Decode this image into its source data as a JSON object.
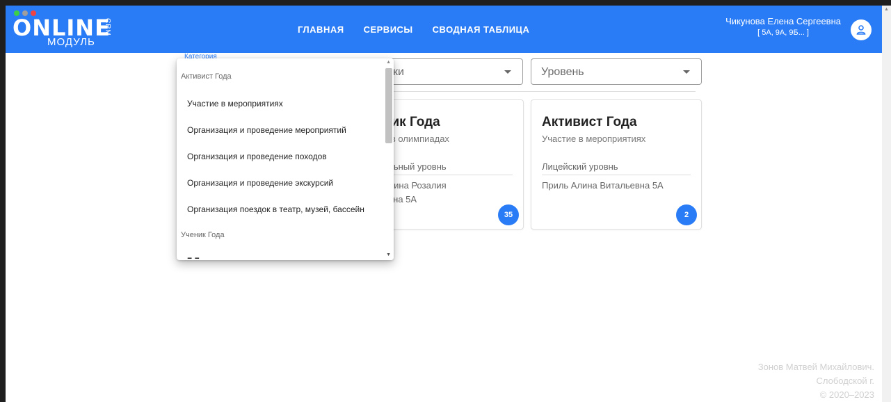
{
  "logo": {
    "word": "ONLINE",
    "crm": "CRM",
    "sub": "МОДУЛЬ",
    "dot_colors": [
      "#3ecf4a",
      "#9e9e9e",
      "#f04343"
    ]
  },
  "nav": {
    "items": [
      "ГЛАВНАЯ",
      "СЕРВИСЫ",
      "СВОДНАЯ ТАБЛИЦА"
    ]
  },
  "user": {
    "name": "Чикунова Елена Сергеевна",
    "groups": "[ 5А, 9А, 9Б... ]",
    "icon": "user-icon"
  },
  "filters": {
    "category_label": "Категория",
    "type_value": "ки",
    "level_placeholder": "Уровень"
  },
  "dropdown": {
    "groups": [
      {
        "label": "Активист Года",
        "items": [
          "Участие в мероприятиях",
          "Организация и проведение мероприятий",
          "Организация и проведение походов",
          "Организация и проведение экскурсий",
          "Организация поездок в театр, музей, бассейн"
        ]
      },
      {
        "label": "Ученик Года",
        "items": []
      }
    ]
  },
  "cards": [
    {
      "title": "ник Года",
      "subtitle": "е в олимпиадах",
      "level": "альный уровнь",
      "person": "ллина Розалия\nевна 5А",
      "count": "35"
    },
    {
      "title": "Активист Года",
      "subtitle": "Участие в мероприятиях",
      "level": "Лицейский уровнь",
      "person": "Приль Алина Витальевна 5А",
      "count": "2"
    }
  ],
  "footer": {
    "line1": "Зонов Матвей Михайлович.",
    "line2": "Слободской г.",
    "line3": "© 2020–2023"
  },
  "colors": {
    "primary": "#2a7cf6"
  }
}
